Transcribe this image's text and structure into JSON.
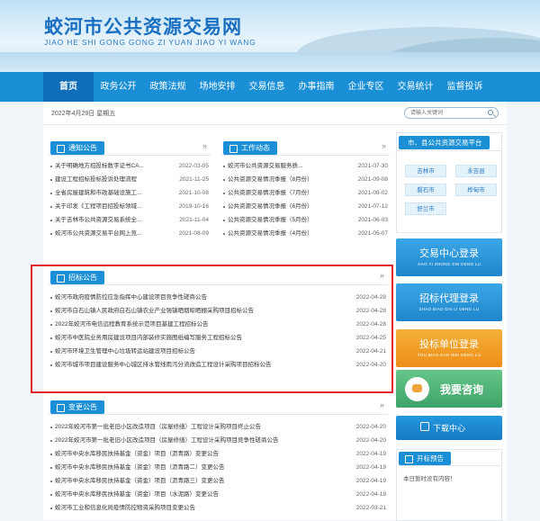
{
  "header": {
    "title_cn": "蛟河市公共资源交易网",
    "title_en": "JIAO HE SHI GONG GONG ZI YUAN JIAO YI WANG"
  },
  "nav": [
    "首页",
    "政务公开",
    "政策法规",
    "场地安排",
    "交易信息",
    "办事指南",
    "企业专区",
    "交易统计",
    "监督投诉"
  ],
  "bar": {
    "date": "2022年4月29日  星期五",
    "search_placeholder": "请输入关键词"
  },
  "notice": {
    "title": "通知公告",
    "items": [
      {
        "t": "关于明确地方招投标数字证书CA...",
        "d": "2022-03-05"
      },
      {
        "t": "建设工程招标投标投诉处理流程",
        "d": "2021-11-25"
      },
      {
        "t": "全省房屋建筑和市政基础设施工...",
        "d": "2021-10-08"
      },
      {
        "t": "关于印发《工程项目招投标领域...",
        "d": "2019-10-16"
      },
      {
        "t": "关于吉林市公共资源交易系统全...",
        "d": "2021-11-04"
      },
      {
        "t": "蛟河市公共资源交易平台网上竞...",
        "d": "2021-08-09"
      }
    ]
  },
  "work": {
    "title": "工作动态",
    "items": [
      {
        "t": "蛟河市公共资源交易服务质...",
        "d": "2021-07-30"
      },
      {
        "t": "公共资源交易情况季报（8月份）",
        "d": "2021-09-08"
      },
      {
        "t": "公共资源交易情况季报（7月份）",
        "d": "2021-08-02"
      },
      {
        "t": "公共资源交易情况季报（6月份）",
        "d": "2021-07-12"
      },
      {
        "t": "公共资源交易情况季报（5月份）",
        "d": "2021-06-03"
      },
      {
        "t": "公共资源交易情况季报（4月份）",
        "d": "2021-05-07"
      }
    ]
  },
  "tender": {
    "title": "招标公告",
    "items": [
      {
        "t": "蛟河市政府疫情防控应急指挥中心建设项目竞争性磋商公告",
        "d": "2022-04-28"
      },
      {
        "t": "蛟河市白石山镇人民政府白石山镇农业产业强镇晒烟晾晒棚采购项目招标公告",
        "d": "2022-04-28"
      },
      {
        "t": "2022年蛟河市电信远程教育系统示范项目基建工程招标公告",
        "d": "2022-04-28"
      },
      {
        "t": "蛟河市中医院业务用房建设项目内部装修实施图纸编写服务工程招标公告",
        "d": "2022-04-25"
      },
      {
        "t": "蛟河市环境卫生管理中心垃圾转运站建设项目招标公告",
        "d": "2022-04-21"
      },
      {
        "t": "蛟河市城市项目建设服务中心城区排水管线雨污分流改造工程设计采购项目招标公告",
        "d": "2022-04-20"
      }
    ]
  },
  "change": {
    "title": "变更公告",
    "items": [
      {
        "t": "2022年蛟河市第一批老旧小区改造项目（房屋修缮）工程设计采购项目终止公告",
        "d": "2022-04-20"
      },
      {
        "t": "2022年蛟河市第一批老旧小区改造项目（房屋修缮）工程设计采购项目竞争性磋商公告",
        "d": "2022-04-20"
      },
      {
        "t": "蛟河市中央水库移民扶持基金（资金）项目（沥青路）变更公告",
        "d": "2022-04-19"
      },
      {
        "t": "蛟河市中央水库移民扶持基金（资金）项目（沥青路二）变更公告",
        "d": "2022-04-19"
      },
      {
        "t": "蛟河市中央水库移民扶持基金（资金）项目（沥青路三）变更公告",
        "d": "2022-04-19"
      },
      {
        "t": "蛟河市中央水库移民扶持基金（资金）项目（水泥路）变更公告",
        "d": "2022-04-19"
      },
      {
        "t": "蛟河市工业和信息化局疫情防控物资采购项目变更公告",
        "d": "2022-03-21"
      }
    ]
  },
  "side": {
    "city_title": "市、县公共资源交易平台",
    "cities": [
      "吉林市",
      "永吉县",
      "磐石市",
      "桦甸市",
      "舒兰市"
    ],
    "b1_cn": "交易中心登录",
    "b1_en": "JIAO YI ZHONG XIN DENG LU",
    "b2_cn": "招标代理登录",
    "b2_en": "ZHAO BIAO DAI LI DENG LU",
    "b3_cn": "投标单位登录",
    "b3_en": "TOU BIAO DAN WEI DENG LU",
    "b4_cn": "我要咨询",
    "b5_cn": "下载中心",
    "notice_title": "开标预告",
    "notice_text": "本日暂时没有内容！"
  }
}
